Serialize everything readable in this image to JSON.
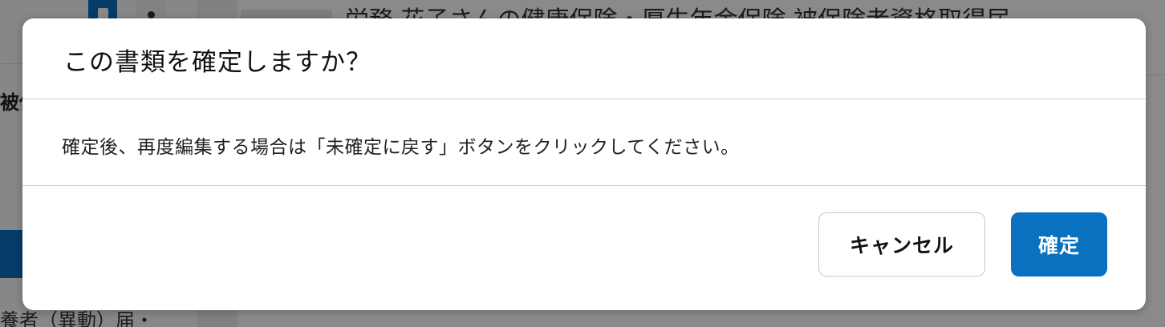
{
  "background": {
    "left_label": "被保",
    "left_bottom_text": "養者（異動）届・",
    "header_title": "労務 花子さんの健康保険・厚生年金保険 被保険者資格取得届"
  },
  "dialog": {
    "title": "この書類を確定しますか？",
    "message": "確定後、再度編集する場合は「未確定に戻す」ボタンをクリックしてください。",
    "cancel_label": "キャンセル",
    "confirm_label": "確定"
  },
  "colors": {
    "primary": "#0a70c0",
    "overlay": "rgba(0,0,0,0.46)"
  },
  "icons": {
    "toolbar_document": "document-icon",
    "toolbar_user": "user-icon"
  }
}
